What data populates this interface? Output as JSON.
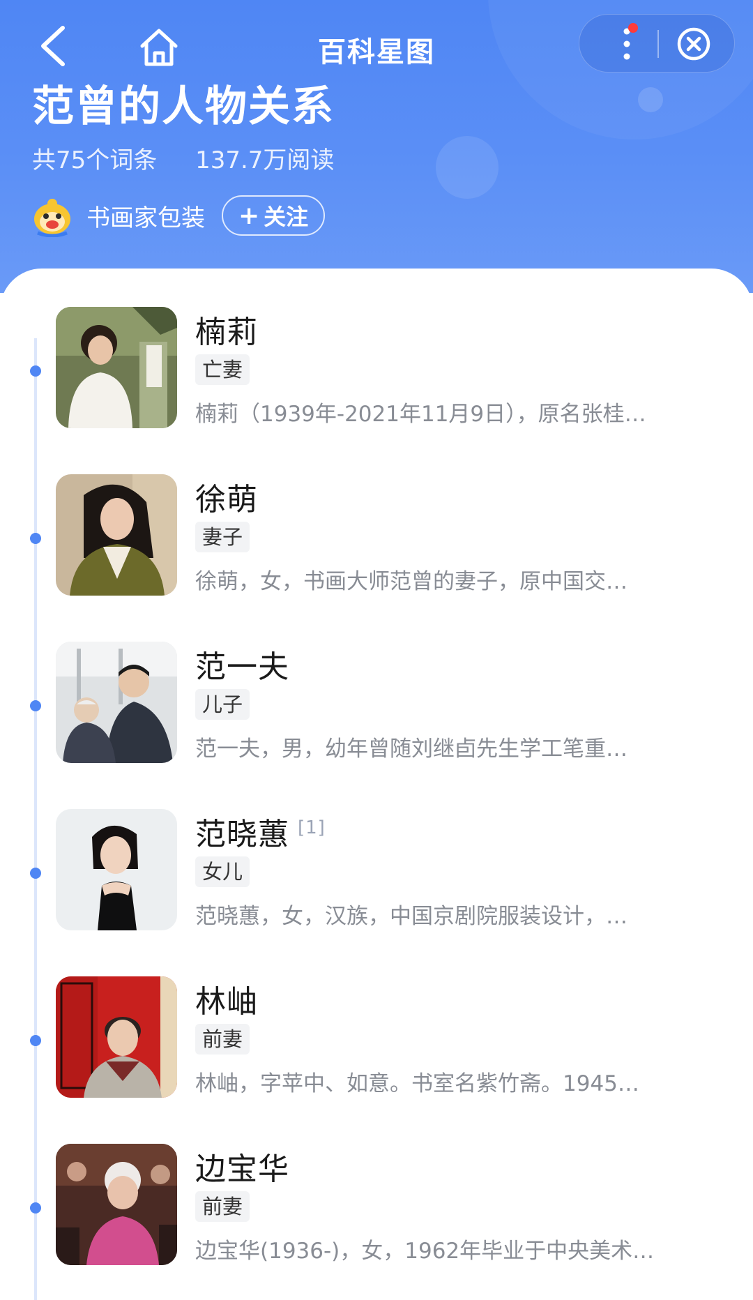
{
  "nav": {
    "title": "百科星图",
    "icons": {
      "back": "back-arrow-icon",
      "home": "home-icon",
      "more": "more-vertical-icon",
      "close": "close-circle-icon"
    }
  },
  "header": {
    "title": "范曾的人物关系",
    "entry_count": "共75个词条",
    "read_count": "137.7万阅读",
    "author": {
      "name": "书画家包装",
      "avatar_icon": "mascot-avatar-icon"
    },
    "follow_button": {
      "plus": "+",
      "label": "关注"
    }
  },
  "colors": {
    "header_blue": "#4f86f4",
    "timeline_dot": "#4f86f4",
    "notification_dot": "#ff3b3b"
  },
  "entries": [
    {
      "name": "楠莉",
      "ref": "",
      "relation": "亡妻",
      "description": "楠莉（1939年-2021年11月9日），原名张桂…"
    },
    {
      "name": "徐萌",
      "ref": "",
      "relation": "妻子",
      "description": "徐萌，女，书画大师范曾的妻子，原中国交…"
    },
    {
      "name": "范一夫",
      "ref": "",
      "relation": "儿子",
      "description": "范一夫，男，幼年曾随刘继卣先生学工笔重…"
    },
    {
      "name": "范晓蕙",
      "ref": "[1]",
      "relation": "女儿",
      "description": "范晓蕙，女，汉族，中国京剧院服装设计，…"
    },
    {
      "name": "林岫",
      "ref": "",
      "relation": "前妻",
      "description": "林岫，字苹中、如意。书室名紫竹斋。1945…"
    },
    {
      "name": "边宝华",
      "ref": "",
      "relation": "前妻",
      "description": "边宝华(1936-)，女，1962年毕业于中央美术…"
    }
  ]
}
